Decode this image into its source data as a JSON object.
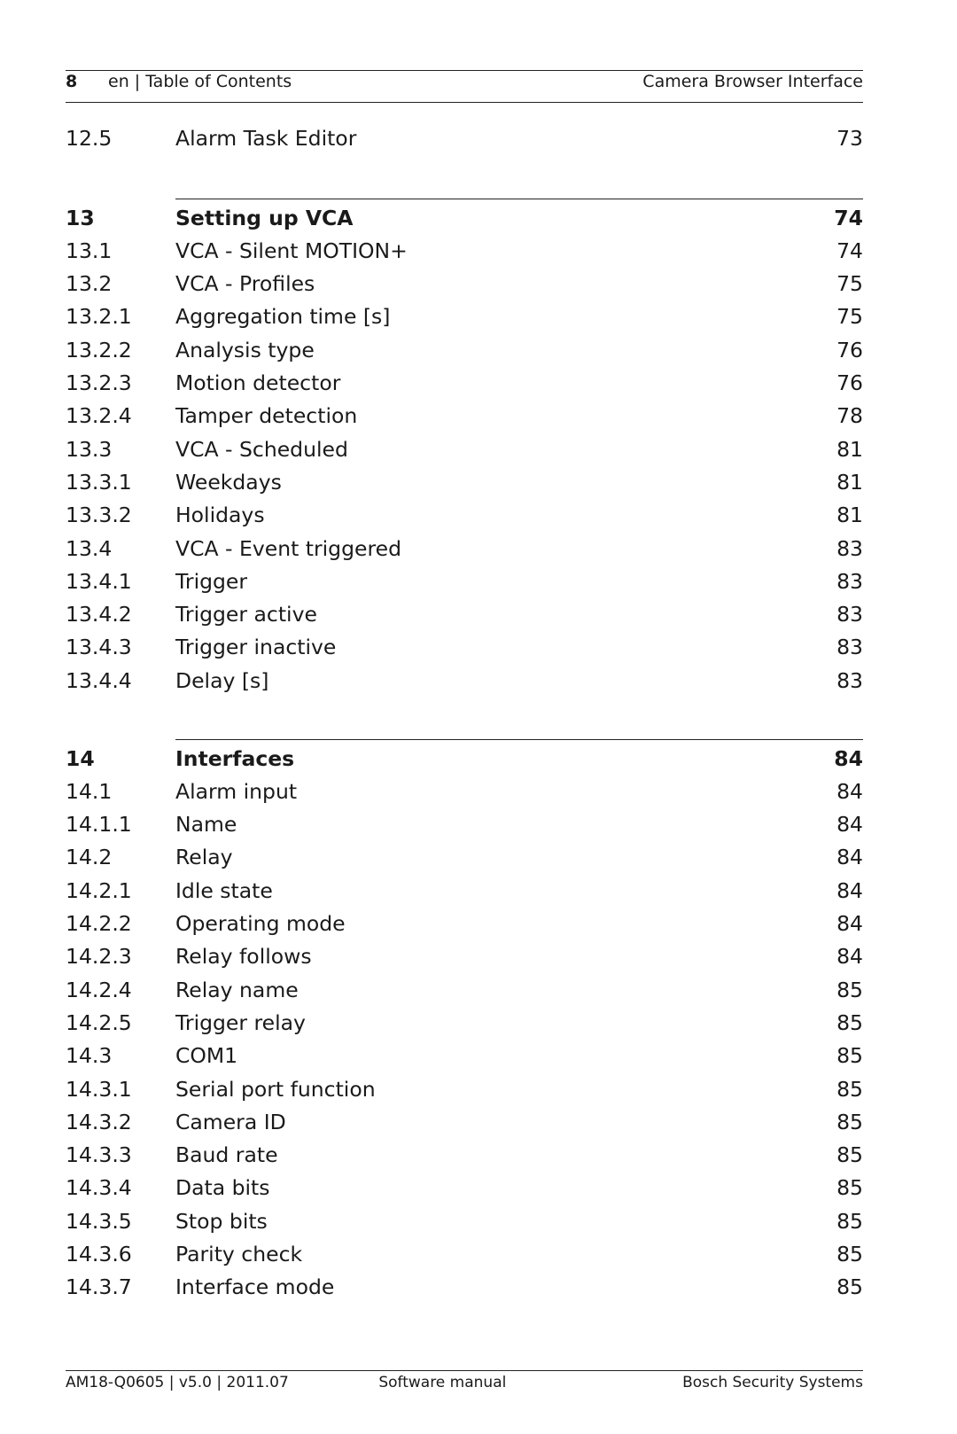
{
  "header": {
    "page_number": "8",
    "section": "en | Table of Contents",
    "document": "Camera Browser Interface"
  },
  "groups": [
    {
      "entries": [
        {
          "num": "12.5",
          "title": "Alarm Task Editor",
          "page": "73"
        }
      ]
    },
    {
      "heading": {
        "num": "13",
        "title": "Setting up VCA",
        "page": "74"
      },
      "entries": [
        {
          "num": "13.1",
          "title": "VCA - Silent MOTION+",
          "page": "74"
        },
        {
          "num": "13.2",
          "title": "VCA - Profiles",
          "page": "75"
        },
        {
          "num": "13.2.1",
          "title": "Aggregation time [s]",
          "page": "75"
        },
        {
          "num": "13.2.2",
          "title": "Analysis type",
          "page": "76"
        },
        {
          "num": "13.2.3",
          "title": "Motion detector",
          "page": "76"
        },
        {
          "num": "13.2.4",
          "title": "Tamper detection",
          "page": "78"
        },
        {
          "num": "13.3",
          "title": "VCA - Scheduled",
          "page": "81"
        },
        {
          "num": "13.3.1",
          "title": "Weekdays",
          "page": "81"
        },
        {
          "num": "13.3.2",
          "title": "Holidays",
          "page": "81"
        },
        {
          "num": "13.4",
          "title": "VCA - Event triggered",
          "page": "83"
        },
        {
          "num": "13.4.1",
          "title": "Trigger",
          "page": "83"
        },
        {
          "num": "13.4.2",
          "title": "Trigger active",
          "page": "83"
        },
        {
          "num": "13.4.3",
          "title": "Trigger inactive",
          "page": "83"
        },
        {
          "num": "13.4.4",
          "title": "Delay [s]",
          "page": "83"
        }
      ]
    },
    {
      "heading": {
        "num": "14",
        "title": "Interfaces",
        "page": "84"
      },
      "entries": [
        {
          "num": "14.1",
          "title": "Alarm input",
          "page": "84"
        },
        {
          "num": "14.1.1",
          "title": "Name",
          "page": "84"
        },
        {
          "num": "14.2",
          "title": "Relay",
          "page": "84"
        },
        {
          "num": "14.2.1",
          "title": "Idle state",
          "page": "84"
        },
        {
          "num": "14.2.2",
          "title": "Operating mode",
          "page": "84"
        },
        {
          "num": "14.2.3",
          "title": "Relay follows",
          "page": "84"
        },
        {
          "num": "14.2.4",
          "title": "Relay name",
          "page": "85"
        },
        {
          "num": "14.2.5",
          "title": "Trigger relay",
          "page": "85"
        },
        {
          "num": "14.3",
          "title": "COM1",
          "page": "85"
        },
        {
          "num": "14.3.1",
          "title": "Serial port function",
          "page": "85"
        },
        {
          "num": "14.3.2",
          "title": "Camera ID",
          "page": "85"
        },
        {
          "num": "14.3.3",
          "title": "Baud rate",
          "page": "85"
        },
        {
          "num": "14.3.4",
          "title": "Data bits",
          "page": "85"
        },
        {
          "num": "14.3.5",
          "title": "Stop bits",
          "page": "85"
        },
        {
          "num": "14.3.6",
          "title": "Parity check",
          "page": "85"
        },
        {
          "num": "14.3.7",
          "title": "Interface mode",
          "page": "85"
        }
      ]
    }
  ],
  "footer": {
    "doc_id": "AM18-Q0605 | v5.0 | 2011.07",
    "doc_type": "Software manual",
    "publisher": "Bosch Security Systems"
  }
}
